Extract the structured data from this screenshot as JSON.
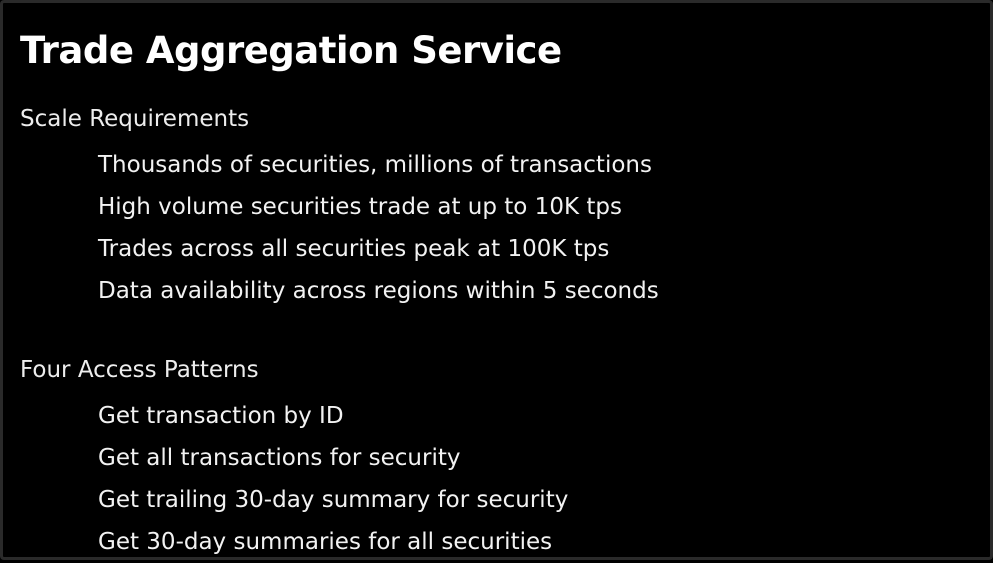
{
  "slide": {
    "title": "Trade Aggregation Service",
    "sections": [
      {
        "heading": "Scale Requirements",
        "items": [
          "Thousands of securities, millions of transactions",
          "High volume securities trade at up to 10K tps",
          "Trades across all securities peak at 100K tps",
          "Data availability across regions within 5 seconds"
        ]
      },
      {
        "heading": "Four Access Patterns",
        "items": [
          "Get transaction by ID",
          "Get all transactions for security",
          "Get trailing 30-day summary for security",
          "Get 30-day summaries for all securities"
        ]
      }
    ]
  },
  "colors": {
    "background": "#000000",
    "text": "#ffffff",
    "frame": "#2a2a2a"
  }
}
